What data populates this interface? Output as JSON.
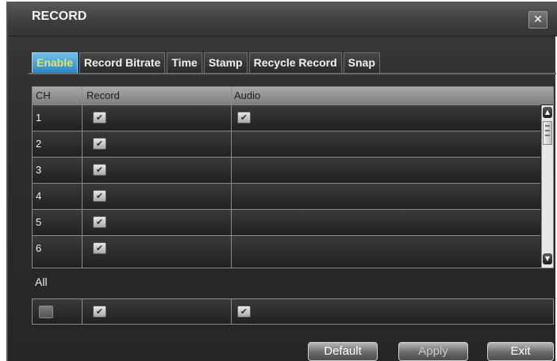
{
  "window": {
    "title": "RECORD",
    "close_label": "✕"
  },
  "tabs": [
    {
      "label": "Enable",
      "active": true
    },
    {
      "label": "Record Bitrate",
      "active": false
    },
    {
      "label": "Time",
      "active": false
    },
    {
      "label": "Stamp",
      "active": false
    },
    {
      "label": "Recycle Record",
      "active": false
    },
    {
      "label": "Snap",
      "active": false
    }
  ],
  "table": {
    "headers": {
      "ch": "CH",
      "record": "Record",
      "audio": "Audio"
    },
    "rows": [
      {
        "ch": "1",
        "record": true,
        "audio": true
      },
      {
        "ch": "2",
        "record": true,
        "audio": false
      },
      {
        "ch": "3",
        "record": true,
        "audio": false
      },
      {
        "ch": "4",
        "record": true,
        "audio": false
      },
      {
        "ch": "5",
        "record": true,
        "audio": false
      },
      {
        "ch": "6",
        "record": true,
        "audio": false
      }
    ]
  },
  "all": {
    "label": "All",
    "record": true,
    "audio": true
  },
  "buttons": {
    "default": "Default",
    "apply": "Apply",
    "exit": "Exit"
  },
  "colors": {
    "active_tab": "#2b86c7",
    "active_tab_text": "#d9ea5a",
    "header_bar": "#8e8e8e"
  },
  "icons": [
    "close-icon",
    "checkbox-check-icon",
    "scroll-up-icon",
    "scroll-down-icon"
  ]
}
